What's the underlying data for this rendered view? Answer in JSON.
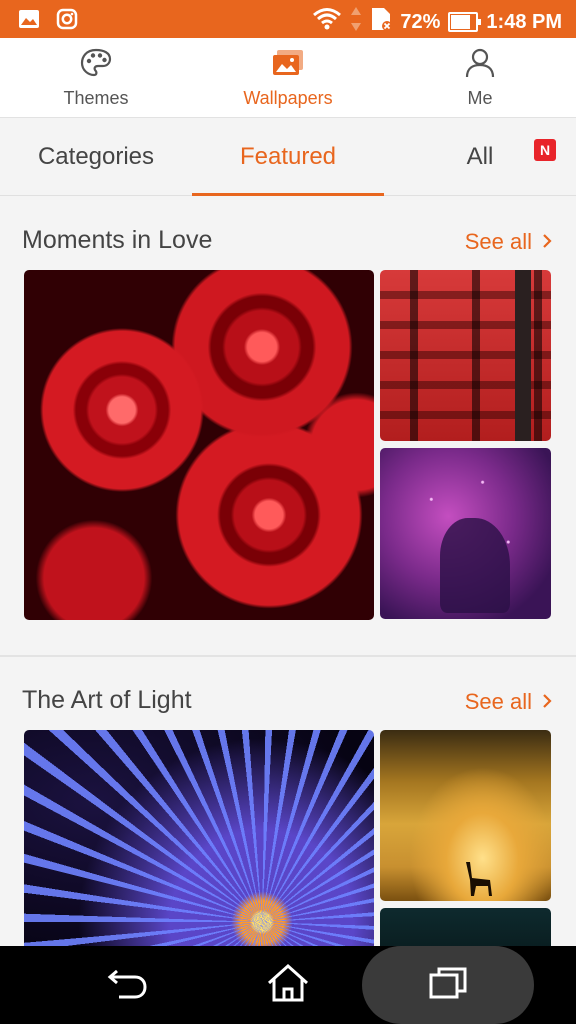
{
  "status_bar": {
    "battery_percent": "72%",
    "time": "1:48 PM",
    "battery_level": 0.72,
    "icons": [
      "gallery-icon",
      "instagram-icon",
      "wifi-icon",
      "data-arrows-icon",
      "sim-icon",
      "battery-icon"
    ]
  },
  "top_nav": {
    "items": [
      {
        "label": "Themes",
        "icon": "palette-icon"
      },
      {
        "label": "Wallpapers",
        "icon": "wallpaper-icon"
      },
      {
        "label": "Me",
        "icon": "person-icon"
      }
    ],
    "active_index": 1
  },
  "tabs": {
    "items": [
      {
        "label": "Categories"
      },
      {
        "label": "Featured"
      },
      {
        "label": "All"
      }
    ],
    "active_index": 1,
    "new_badge": "N"
  },
  "sections": [
    {
      "title": "Moments in Love",
      "see_all": "See all"
    },
    {
      "title": "The Art of Light",
      "see_all": "See all"
    }
  ],
  "colors": {
    "accent": "#e8661e",
    "status_bar": "#e8661e",
    "badge": "#e8242a"
  },
  "system_nav": {
    "icons": [
      "back-icon",
      "home-icon",
      "recent-apps-icon"
    ]
  }
}
